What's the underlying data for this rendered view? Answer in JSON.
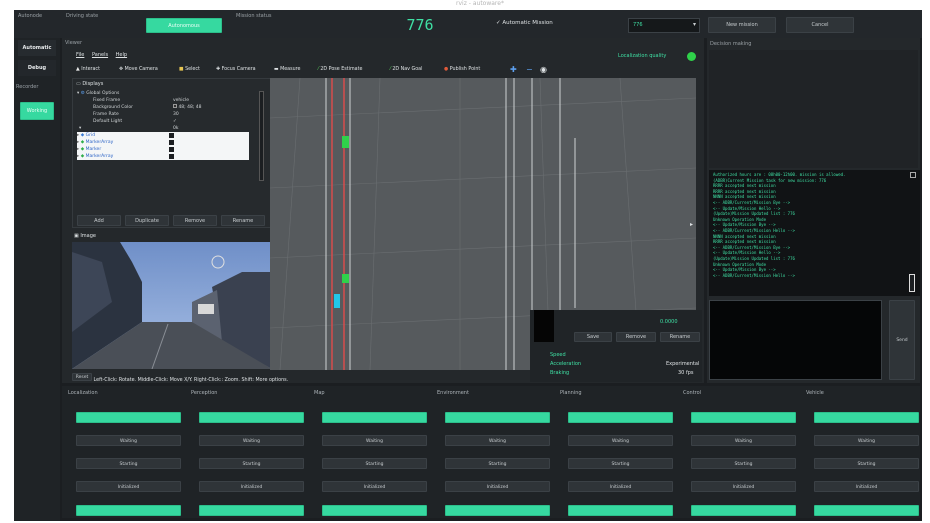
{
  "window_title": "rviz - autoware*",
  "topbar": {
    "autonode_label": "Autonode",
    "driving_state_label": "Driving state",
    "driving_state_value": "Autonomous",
    "mission_status_label": "Mission status",
    "mission_number": "776",
    "automatic_mission_label": "✓ Automatic Mission",
    "mission_select_value": "776",
    "new_mission_label": "New mission",
    "cancel_label": "Cancel"
  },
  "sidebar": {
    "automatic": "Automatic",
    "debug": "Debug",
    "recorder": "Recorder",
    "working": "Working"
  },
  "viewer": {
    "title": "Viewer",
    "menu": [
      "File",
      "Panels",
      "Help"
    ],
    "localization_quality": "Localization quality",
    "tools": [
      "Interact",
      "Move Camera",
      "Select",
      "Focus Camera",
      "Measure",
      "2D Pose Estimate",
      "2D Nav Goal",
      "Publish Point"
    ]
  },
  "displays": {
    "header": "Displays",
    "global_options": "Global Options",
    "rows": [
      {
        "name": "Fixed Frame",
        "value": "vehicle"
      },
      {
        "name": "Background Color",
        "value": "48; 48; 48"
      },
      {
        "name": "Frame Rate",
        "value": "30"
      },
      {
        "name": "Default Light",
        "value": "✓"
      }
    ],
    "zero_value": "0k",
    "items": [
      "Grid",
      "MarkerArray",
      "Marker",
      "MarkerArray"
    ],
    "buttons": [
      "Add",
      "Duplicate",
      "Remove",
      "Rename"
    ]
  },
  "image_panel": {
    "title": "Image"
  },
  "statusbar": {
    "reset": "Reset",
    "hint": "Left-Click: Rotate. Middle-Click: Move X/Y. Right-Click:: Zoom. Shift: More options."
  },
  "views": {
    "value": "0.0000",
    "buttons": [
      "Save",
      "Remove",
      "Rename"
    ],
    "speed_label": "Speed",
    "acceleration_label": "Acceleration",
    "acceleration_value": "Experimental",
    "braking_label": "Braking",
    "braking_value": "30 fps"
  },
  "decision": {
    "title": "Decision making",
    "log": [
      "Authorized hours are : 08h00-12h00. mission is allowed.",
      "(ADBR)Current Mission task for new mission: 776",
      "RRRR accepted next mission",
      "RRRR accepted next mission",
      "NNNN accepted next mission",
      "<-- ADBR/Current/Mission Bye -->",
      "<-- Update/Mission Hello -->",
      "(Update)Mission Updated list : 776",
      "Unknown Operation Mode",
      "<-- Update/Mission Bye -->",
      "<-- ADBR/Current/Mission Hello -->",
      "NNNN accepted next mission",
      "RRRR accepted next mission",
      "<-- ADBR/Current/Mission Bye -->",
      "<-- Update/Mission Hello -->",
      "(Update)Mission Updated list : 776",
      "Unknown Operation Mode",
      "<-- Update/Mission Bye -->",
      "<-- ADBR/Current/Mission Hello -->"
    ],
    "side_button": "Send"
  },
  "modules": [
    {
      "name": "Localization",
      "status": [
        "Waiting",
        "Starting",
        "Initialized"
      ]
    },
    {
      "name": "Perception",
      "status": [
        "Waiting",
        "Starting",
        "Initialized"
      ]
    },
    {
      "name": "Map",
      "status": [
        "Waiting",
        "Starting",
        "Initialized"
      ]
    },
    {
      "name": "Environment",
      "status": [
        "Waiting",
        "Starting",
        "Initialized"
      ]
    },
    {
      "name": "Planning",
      "status": [
        "Waiting",
        "Starting",
        "Initialized"
      ]
    },
    {
      "name": "Control",
      "status": [
        "Waiting",
        "Starting",
        "Initialized"
      ]
    },
    {
      "name": "Vehicle",
      "status": [
        "Waiting",
        "Starting",
        "Initialized"
      ]
    }
  ],
  "colors": {
    "accent": "#36d9a0",
    "background": "#1b1e21",
    "log_text": "#3fe0a4"
  }
}
